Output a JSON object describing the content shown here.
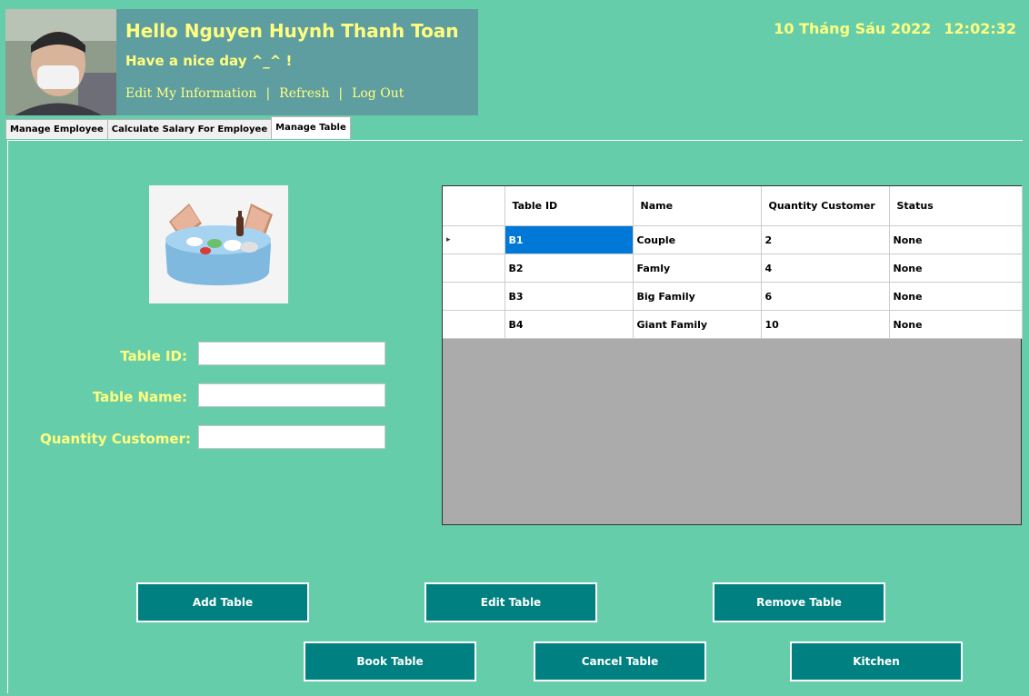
{
  "header": {
    "greeting": "Hello Nguyen Huynh Thanh Toan",
    "subtitle": "Have a nice day ^_^ !",
    "links": [
      "Edit My Information",
      "Refresh",
      "Log Out"
    ],
    "separator": "|",
    "date": "10 Tháng Sáu 2022",
    "time": "12:02:32"
  },
  "tabs": [
    {
      "label": "Manage Employee"
    },
    {
      "label": "Calculate Salary For Employee"
    },
    {
      "label": "Manage Table"
    }
  ],
  "form": {
    "table_id_label": "Table ID:",
    "table_id_value": "",
    "table_name_label": "Table Name:",
    "table_name_value": "",
    "quantity_label": "Quantity Customer:",
    "quantity_value": ""
  },
  "grid": {
    "columns": [
      "Table ID",
      "Name",
      "Quantity Customer",
      "Status"
    ],
    "current_row_marker": "▸",
    "rows": [
      {
        "id": "B1",
        "name": "Couple",
        "quantity": "2",
        "status": "None"
      },
      {
        "id": "B2",
        "name": "Famly",
        "quantity": "4",
        "status": "None"
      },
      {
        "id": "B3",
        "name": "Big Family",
        "quantity": "6",
        "status": "None"
      },
      {
        "id": "B4",
        "name": "Giant Family",
        "quantity": "10",
        "status": "None"
      }
    ]
  },
  "buttons": {
    "add": "Add Table",
    "edit": "Edit Table",
    "remove": "Remove Table",
    "book": "Book Table",
    "cancel": "Cancel Table",
    "kitchen": "Kitchen"
  },
  "colors": {
    "background": "#66cdaa",
    "header_panel": "#5f9ea0",
    "text_accent": "#ffff80",
    "button": "#008080",
    "selection": "#0078d7"
  }
}
